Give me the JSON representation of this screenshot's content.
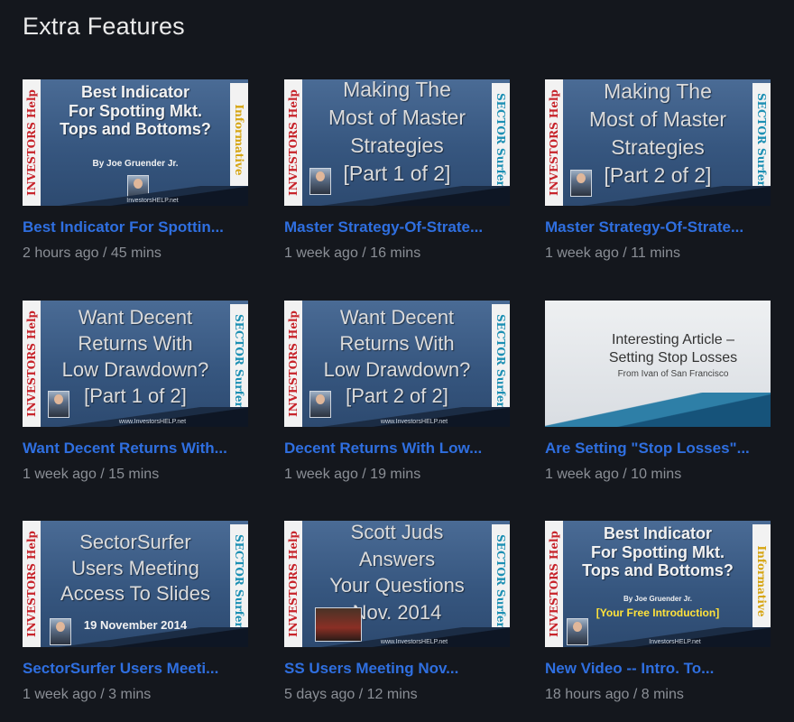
{
  "section": {
    "title": "Extra Features"
  },
  "labels": {
    "investors_help": "INVESTORS Help",
    "sector_surfer": "SECTOR Surfer",
    "informative": "Informative"
  },
  "videos": [
    {
      "title": "Best Indicator For Spottin...",
      "meta": "2 hours ago / 45 mins",
      "thumb": {
        "headline": "Best Indicator\nFor Spotting Mkt.\nTops and Bottoms?",
        "byline": "By Joe Gruender Jr.",
        "url": "InvestorsHELP.net"
      }
    },
    {
      "title": "Master Strategy-Of-Strate...",
      "meta": "1 week ago / 16 mins",
      "thumb": {
        "url_top": "www.InvestorsHELP.net",
        "headline": "Making The\nMost of Master\nStrategies\n[Part 1 of 2]"
      }
    },
    {
      "title": "Master Strategy-Of-Strate...",
      "meta": "1 week ago / 11 mins",
      "thumb": {
        "headline": "Making The\nMost of Master\nStrategies\n[Part 2 of 2]"
      }
    },
    {
      "title": "Want Decent Returns With...",
      "meta": "1 week ago / 15 mins",
      "thumb": {
        "headline": "Want Decent\nReturns With\nLow Drawdown?\n[Part 1 of 2]",
        "url": "www.InvestorsHELP.net"
      }
    },
    {
      "title": "Decent Returns With Low...",
      "meta": "1 week ago / 19 mins",
      "thumb": {
        "headline": "Want Decent\nReturns With\nLow Drawdown?\n[Part 2 of 2]",
        "url": "www.InvestorsHELP.net"
      }
    },
    {
      "title": "Are Setting \"Stop Losses\"...",
      "meta": "1 week ago / 10 mins",
      "thumb": {
        "headline": "Interesting Article –\nSetting Stop Losses",
        "byline": "From Ivan of San Francisco"
      }
    },
    {
      "title": "SectorSurfer Users Meeti...",
      "meta": "1 week ago / 3 mins",
      "thumb": {
        "headline": "SectorSurfer\nUsers Meeting\nAccess To Slides",
        "byline": "19 November 2014"
      }
    },
    {
      "title": "SS Users Meeting Nov...",
      "meta": "5 days ago / 12 mins",
      "thumb": {
        "headline": "Scott Juds\nAnswers\nYour Questions\nNov. 2014",
        "url": "www.InvestorsHELP.net"
      }
    },
    {
      "title": "New Video -- Intro. To...",
      "meta": "18 hours ago / 8 mins",
      "thumb": {
        "headline": "Best Indicator\nFor Spotting Mkt.\nTops and Bottoms?",
        "byline": "By Joe Gruender Jr.",
        "yellow": "[Your Free Introduction]",
        "url": "InvestorsHELP.net"
      }
    }
  ]
}
